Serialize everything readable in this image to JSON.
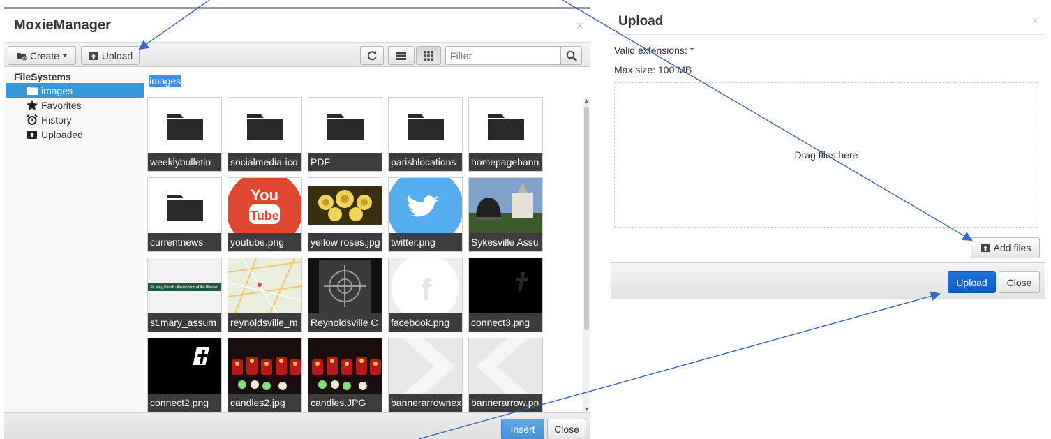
{
  "moxie": {
    "title": "MoxieManager",
    "close_glyph": "×",
    "toolbar": {
      "create_label": "Create",
      "upload_label": "Upload",
      "filter_placeholder": "Filter"
    },
    "sidebar": {
      "heading": "FileSystems",
      "items": [
        {
          "label": "images",
          "icon": "folder-open-icon",
          "active": true
        },
        {
          "label": "Favorites",
          "icon": "star-icon"
        },
        {
          "label": "History",
          "icon": "alarm-clock-icon"
        },
        {
          "label": "Uploaded",
          "icon": "upload-box-icon"
        }
      ]
    },
    "breadcrumb": "images",
    "files": [
      {
        "name": "weeklybulletin",
        "kind": "folder"
      },
      {
        "name": "socialmedia-ico",
        "kind": "folder"
      },
      {
        "name": "PDF",
        "kind": "folder"
      },
      {
        "name": "parishlocations",
        "kind": "folder"
      },
      {
        "name": "homepagebann",
        "kind": "folder"
      },
      {
        "name": "currentnews",
        "kind": "folder"
      },
      {
        "name": "youtube.png",
        "kind": "youtube"
      },
      {
        "name": "yellow roses.jpg",
        "kind": "roses"
      },
      {
        "name": "twitter.png",
        "kind": "twitter"
      },
      {
        "name": "Sykesville Assu",
        "kind": "church"
      },
      {
        "name": "st.mary_assum",
        "kind": "banner"
      },
      {
        "name": "reynoldsville_m",
        "kind": "map"
      },
      {
        "name": "Reynoldsville C",
        "kind": "window"
      },
      {
        "name": "facebook.png",
        "kind": "facebook"
      },
      {
        "name": "connect3.png",
        "kind": "connect3"
      },
      {
        "name": "connect2.png",
        "kind": "connect2"
      },
      {
        "name": "candles2.jpg",
        "kind": "candles"
      },
      {
        "name": "candles.JPG",
        "kind": "candles"
      },
      {
        "name": "bannerarrownex",
        "kind": "arrow-right"
      },
      {
        "name": "bannerarrow.pn",
        "kind": "arrow-left"
      }
    ],
    "footer": {
      "insert_label": "Insert",
      "close_label": "Close"
    }
  },
  "upload": {
    "title": "Upload",
    "close_glyph": "×",
    "valid_extensions": "Valid extensions: *",
    "max_size": "Max size: 100 MB",
    "drop_hint": "Drag files here",
    "add_files_label": "Add files",
    "upload_label": "Upload",
    "close_label": "Close"
  },
  "colors": {
    "selection": "#3498db",
    "primary_light": "#4591d5",
    "primary_dark": "#0e5fc0",
    "arrow": "#2b5db8"
  }
}
